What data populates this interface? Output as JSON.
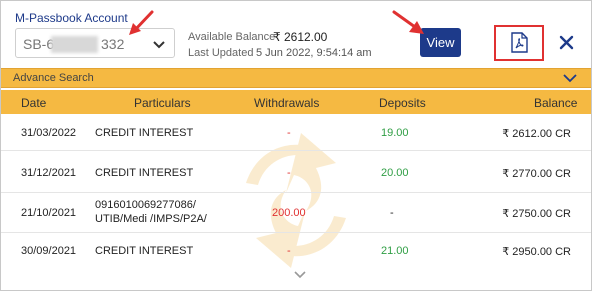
{
  "header": {
    "account_label": "M-Passbook Account",
    "account_value_prefix": "SB-6",
    "account_value_suffix": "332",
    "balance_label": "Available Balance",
    "balance_value": "₹ 2612.00",
    "updated_label": "Last Updated",
    "updated_value": "5 Jun 2022, 9:54:14 am",
    "view_label": "View"
  },
  "advanced_search": {
    "label": "Advance Search"
  },
  "table": {
    "headers": {
      "date": "Date",
      "particulars": "Particulars",
      "withdrawals": "Withdrawals",
      "deposits": "Deposits",
      "balance": "Balance"
    },
    "rows": [
      {
        "date": "31/03/2022",
        "particulars": [
          "CREDIT INTEREST"
        ],
        "withdrawal": "-",
        "deposit": "19.00",
        "balance": "₹ 2612.00 CR"
      },
      {
        "date": "31/12/2021",
        "particulars": [
          "CREDIT INTEREST"
        ],
        "withdrawal": "-",
        "deposit": "20.00",
        "balance": "₹ 2770.00 CR"
      },
      {
        "date": "21/10/2021",
        "particulars": [
          "0916010069277086/",
          "UTIB/Medi /IMPS/P2A/"
        ],
        "withdrawal": "200.00",
        "deposit": "-",
        "balance": "₹ 2750.00 CR"
      },
      {
        "date": "30/09/2021",
        "particulars": [
          "CREDIT INTEREST"
        ],
        "withdrawal": "-",
        "deposit": "21.00",
        "balance": "₹ 2950.00 CR"
      }
    ]
  },
  "colors": {
    "brand_blue": "#1d3a8a",
    "accent_yellow": "#f5b942",
    "annotation_red": "#e03131",
    "deposit_green": "#2f9e44"
  },
  "icons": {
    "dropdown": "chevron-down-icon",
    "pdf": "pdf-icon",
    "close": "close-icon",
    "expand": "chevron-down-icon",
    "watermark": "refresh-arrows-icon"
  }
}
